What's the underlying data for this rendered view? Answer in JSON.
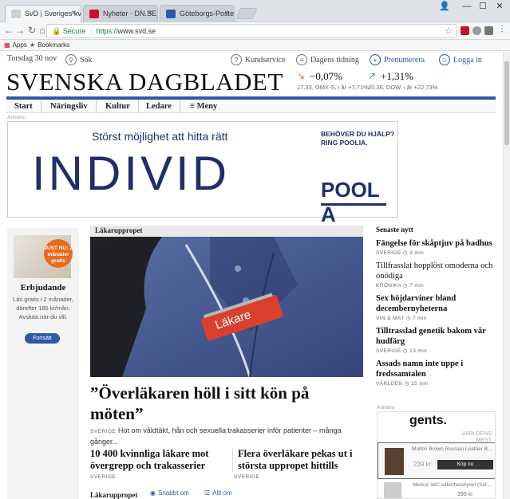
{
  "browser": {
    "tabs": [
      {
        "label": "SvD | Sveriges kvalitetss...",
        "close": "×",
        "active": true,
        "favicon_color": "#d0d0d0"
      },
      {
        "label": "Nyheter - DN.SE",
        "close": "×",
        "active": false,
        "favicon_color": "#c8102e"
      },
      {
        "label": "Göteborgs-Posten",
        "close": "×",
        "active": false,
        "favicon_color": "#2e59a6"
      }
    ],
    "window_controls": {
      "account": "👤",
      "minimize": "—",
      "maximize": "☐",
      "close": "✕"
    },
    "secure_label": "Secure",
    "url_protocol": "https://",
    "url": "www.svd.se",
    "bookmarks": [
      {
        "label": "Apps",
        "icon": "apps-grid-icon"
      },
      {
        "label": "Bookmarks",
        "icon": "star-icon"
      }
    ]
  },
  "topline": {
    "date": "Torsdag 30 nov",
    "search": "Sök",
    "kundservice": "Kundservice",
    "dagens_tidning": "Dagens tidning",
    "prenumerera": "Prenumerera",
    "logga_in": "Logga in"
  },
  "masthead": "SVENSKA DAGBLADET",
  "stocks": [
    {
      "pct": "−0,07%",
      "sub": "17.33, OMX-S, i år +7,71%",
      "direction": "down",
      "color": "#e86a1e"
    },
    {
      "pct": "+1,31%",
      "sub": "20.36, DOW, i år +22,73%",
      "direction": "up",
      "color": "#2a9d3a"
    }
  ],
  "nav": [
    "Start",
    "Näringsliv",
    "Kultur",
    "Ledare",
    "≡ Meny"
  ],
  "annons_label": "Annons",
  "ad_top": {
    "tagline": "Störst möjlighet att hitta rätt",
    "brand": "INDIVID",
    "help": "BEHÖVER DU HJÄLP?\nRING POOLIA.",
    "logo": "POOL A"
  },
  "promo": {
    "badge": "JUST NU: 2 månader gratis",
    "title": "Erbjudande",
    "desc": "Läs gratis i 2 månader, därefter 185 kr/mån. Avsluta när du vill.",
    "button": "Fortsätt"
  },
  "main": {
    "kicker": "Läkaruppropet",
    "photo_badge": "Läkare",
    "headline": "”Överläkaren höll i sitt kön på möten”",
    "lead_category": "SVERIGE",
    "lead": "Hot om våldtäkt, hån och sexuella trakasserier inför patienter – många gånger...",
    "sub1": "10 400 kvinnliga läkare mot övergrepp och trakasserier",
    "sub1_cat": "SVERIGE",
    "sub2": "Flera överläkare pekas ut i största uppropet hittills",
    "sub2_cat": "SVERIGE",
    "bottom_kicker": "Läkaruppropet",
    "link1": "Snabbt om",
    "link2": "Allt om"
  },
  "latest": {
    "heading": "Senaste nytt",
    "items": [
      {
        "title": "Fängelse för skåptjuv på badhus",
        "meta": "SVERIGE ◷ 3 min",
        "bold": true
      },
      {
        "title": "Tillfrasslat hopplöst omoderna och onödiga",
        "meta": "KRÖNIKA ◷ 7 min",
        "bold": false
      },
      {
        "title": "Sex höjdarviner bland decembernyheterna",
        "meta": "VIN & MAT ◷ 7 min",
        "bold": true
      },
      {
        "title": "Tilltrasslad genetik bakom vår hudfärg",
        "meta": "SVERIGE ◷ 13 min",
        "bold": true
      },
      {
        "title": "Assads namn inte uppe i fredssamtalen",
        "meta": "VÄRLDEN ◷ 15 min",
        "bold": true
      }
    ]
  },
  "ad_right": {
    "brand": "gents.",
    "bg_text": "VÄRLDENS\nMEST\nPRISVÄRDA",
    "product": "Molton Brown Russian Leather B...",
    "price": "239 kr",
    "button": "Köp nu",
    "product2": "Merkur 34C säkerhetshyvel (Saf...",
    "price2": "399 kr"
  }
}
